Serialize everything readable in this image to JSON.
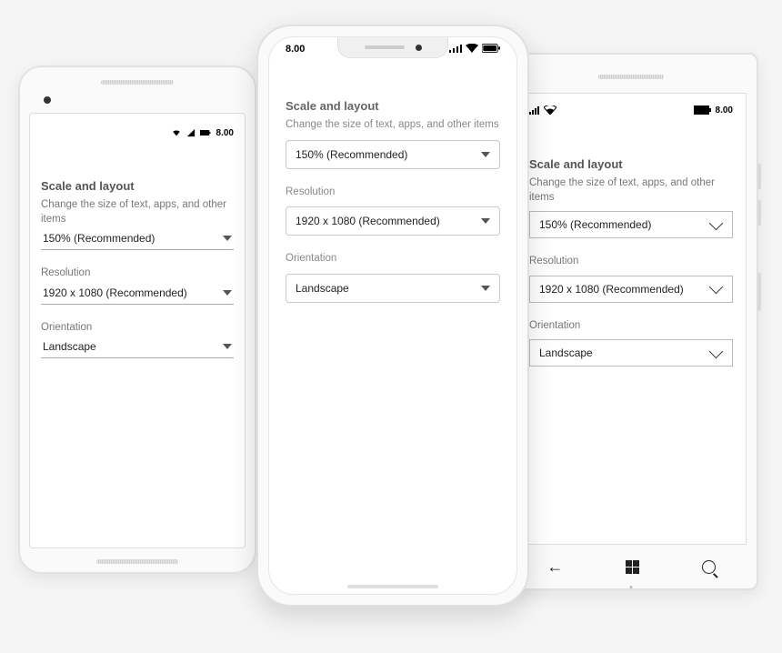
{
  "status": {
    "time": "8.00"
  },
  "settings": {
    "section_title": "Scale and layout",
    "scale_label": "Change the size of text, apps, and other items",
    "scale_value": "150% (Recommended)",
    "resolution_label": "Resolution",
    "resolution_value": "1920 x 1080 (Recommended)",
    "orientation_label": "Orientation",
    "orientation_value": "Landscape"
  }
}
